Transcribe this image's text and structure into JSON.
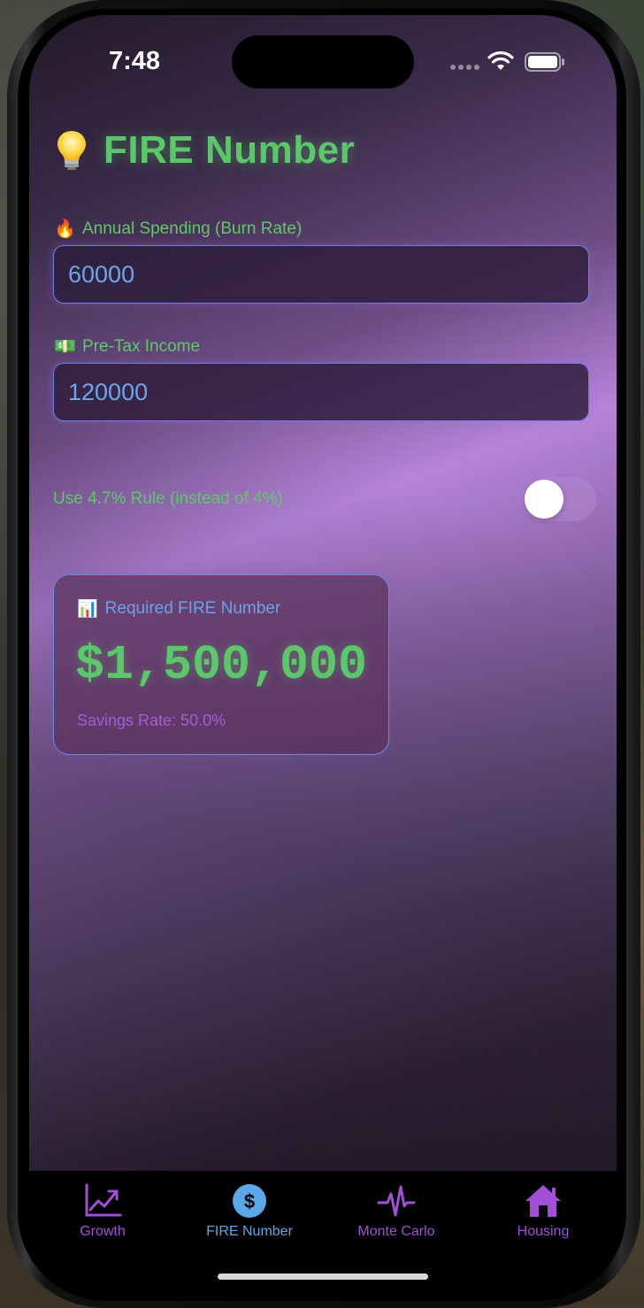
{
  "status_bar": {
    "time": "7:48"
  },
  "header": {
    "icon": "lightbulb-icon",
    "title": "FIRE Number"
  },
  "form": {
    "annual_spending": {
      "emoji": "🔥",
      "label": "Annual Spending (Burn Rate)",
      "value": "60000"
    },
    "pretax_income": {
      "emoji": "💵",
      "label": "Pre-Tax Income",
      "value": "120000"
    },
    "rule_toggle": {
      "label": "Use 4.7% Rule (instead of 4%)",
      "enabled": false
    }
  },
  "result": {
    "emoji": "📊",
    "label": "Required FIRE Number",
    "value": "$1,500,000",
    "savings_rate": "Savings Rate: 50.0%"
  },
  "tabs": [
    {
      "label": "Growth",
      "icon": "chart-line-icon",
      "active": false
    },
    {
      "label": "FIRE Number",
      "icon": "dollar-circle-icon",
      "active": true
    },
    {
      "label": "Monte Carlo",
      "icon": "waveform-icon",
      "active": false
    },
    {
      "label": "Housing",
      "icon": "house-icon",
      "active": false
    }
  ],
  "colors": {
    "accent_green": "#5cc66a",
    "input_text_blue": "#6ea7e6",
    "tab_purple": "#a04fd6",
    "tab_active_blue": "#5aa8e8",
    "savings_purple": "#a65cd6"
  }
}
